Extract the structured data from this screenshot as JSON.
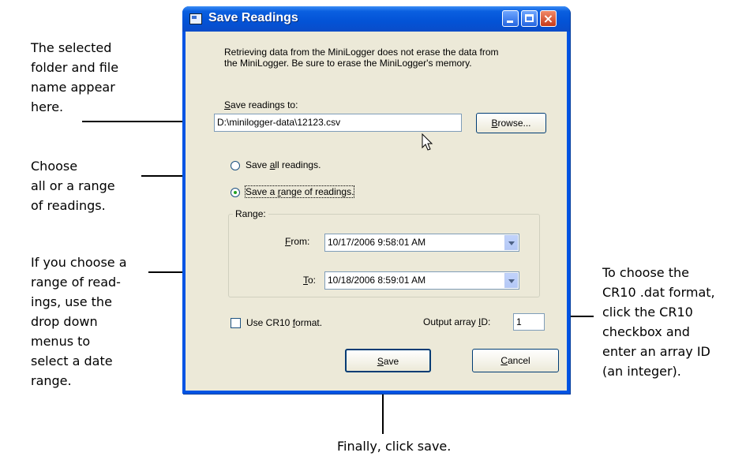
{
  "callouts": {
    "folder_text": "The selected\nfolder and file\nname appear\nhere.",
    "range_text": "Choose\nall or a range\nof readings.",
    "dropdown_text": "If you choose a\nrange of read-\nings, use the\ndrop down\nmenus to\nselect a date\nrange.",
    "cr10_text": "To choose the\nCR10 .dat format,\nclick the CR10\ncheckbox and\nenter an array ID\n(an integer).",
    "save_text": "Finally, click save."
  },
  "dialog": {
    "title": "Save Readings",
    "info": "Retrieving data from the MiniLogger does not erase the data from\nthe MiniLogger.  Be sure to erase the MiniLogger's memory.",
    "save_to_label_first": "S",
    "save_to_label_rest": "ave readings to:",
    "save_to_value": "D:\\minilogger-data\\12123.csv",
    "browse_first": "B",
    "browse_rest": "rowse...",
    "radio_all_pre": "Save ",
    "radio_all_u": "a",
    "radio_all_post": "ll readings.",
    "radio_range_pre": "Save a ",
    "radio_range_u": "r",
    "radio_range_post": "ange of readings.",
    "radio_selected": "range",
    "range_group": "Range:",
    "from_u": "F",
    "from_rest": "rom:",
    "from_value": "10/17/2006 9:58:01 AM",
    "to_u": "T",
    "to_rest": "o:",
    "to_value": "10/18/2006 8:59:01 AM",
    "cr10_pre": "Use CR10 ",
    "cr10_u": "f",
    "cr10_post": "ormat.",
    "cr10_checked": false,
    "array_pre": "Output array ",
    "array_u": "I",
    "array_post": "D:",
    "array_value": "1",
    "save_u": "S",
    "save_rest": "ave",
    "cancel_u": "C",
    "cancel_rest": "ancel"
  },
  "icons": [
    "window-icon",
    "minimize-icon",
    "maximize-icon",
    "close-icon",
    "dropdown-arrow-icon",
    "mouse-cursor-icon"
  ]
}
